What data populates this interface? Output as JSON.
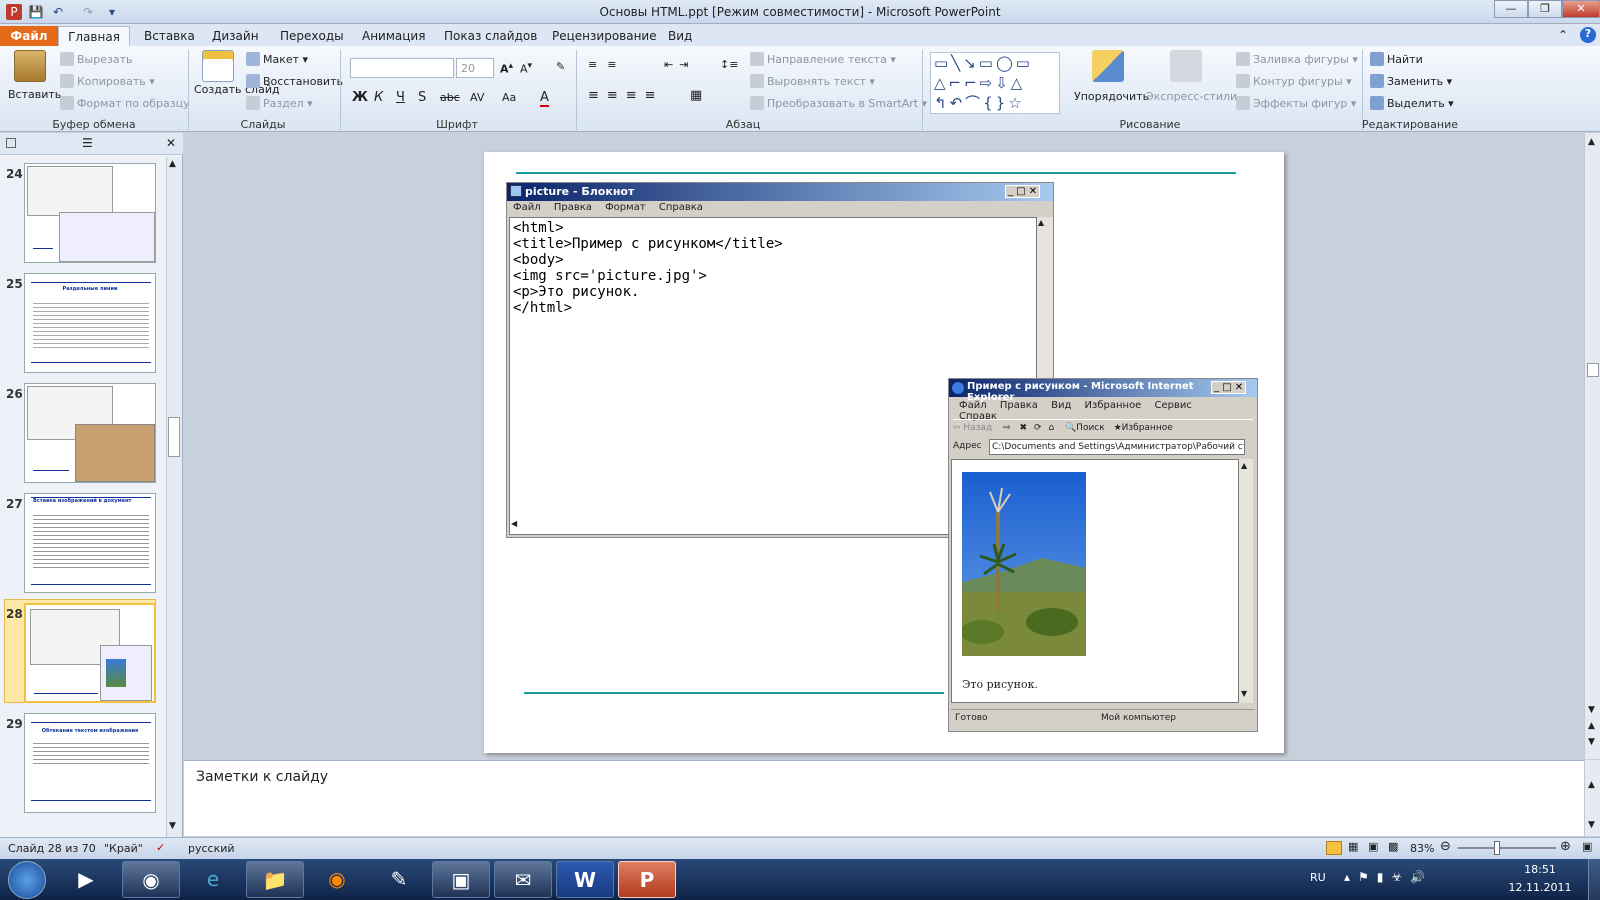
{
  "window": {
    "title": "Основы HTML.ppt [Режим совместимости]  -  Microsoft PowerPoint"
  },
  "tabs": [
    "Файл",
    "Главная",
    "Вставка",
    "Дизайн",
    "Переходы",
    "Анимация",
    "Показ слайдов",
    "Рецензирование",
    "Вид"
  ],
  "ribbon": {
    "clipboard": {
      "paste": "Вставить",
      "cut": "Вырезать",
      "copy": "Копировать",
      "format_painter": "Формат по образцу",
      "label": "Буфер обмена"
    },
    "slides": {
      "new_slide": "Создать слайд",
      "layout": "Макет",
      "reset": "Восстановить",
      "section": "Раздел",
      "label": "Слайды"
    },
    "font": {
      "size": "20",
      "label": "Шрифт",
      "bold": "Ж",
      "italic": "К",
      "underline": "Ч",
      "shadow": "S",
      "strike": "abc",
      "spacing": "AV",
      "case": "Aa",
      "color": "A"
    },
    "paragraph": {
      "text_direction": "Направление текста",
      "align_text": "Выровнять текст",
      "smartart": "Преобразовать в SmartArt",
      "label": "Абзац"
    },
    "drawing": {
      "arrange": "Упорядочить",
      "quick_styles": "Экспресс-стили",
      "fill": "Заливка фигуры",
      "outline": "Контур фигуры",
      "effects": "Эффекты фигур",
      "label": "Рисование"
    },
    "editing": {
      "find": "Найти",
      "replace": "Заменить",
      "select": "Выделить",
      "label": "Редактирование"
    }
  },
  "slides_panel": {
    "numbers": [
      "24",
      "25",
      "26",
      "27",
      "28",
      "29"
    ],
    "titles": {
      "25": "Раздельные линии",
      "27": "Вставка изображений в документ",
      "29": "Обтекание текстом изображения"
    },
    "selected": "28"
  },
  "notepad": {
    "title": "picture - Блокнот",
    "menu": [
      "Файл",
      "Правка",
      "Формат",
      "Справка"
    ],
    "lines": [
      "<html>",
      "<title>Пример с рисунком</title>",
      "<body>",
      "<img src='picture.jpg'>",
      "<p>Это рисунок.",
      "</html>"
    ]
  },
  "ie": {
    "title": "Пример с рисунком - Microsoft Internet Explorer",
    "menu": [
      "Файл",
      "Правка",
      "Вид",
      "Избранное",
      "Сервис",
      "Справк"
    ],
    "back": "Назад",
    "search": "Поиск",
    "favorites": "Избранное",
    "address_label": "Адрес",
    "address": "C:\\Documents and Settings\\Администратор\\Рабочий ст",
    "content_text": "Это рисунок.",
    "status_ready": "Готово",
    "status_zone": "Мой компьютер"
  },
  "notes": {
    "placeholder": "Заметки к слайду"
  },
  "status": {
    "slide": "Слайд 28 из 70",
    "theme": "\"Край\"",
    "lang": "русский",
    "zoom": "83%"
  },
  "tray": {
    "lang": "RU",
    "time": "18:51",
    "date": "12.11.2011"
  }
}
